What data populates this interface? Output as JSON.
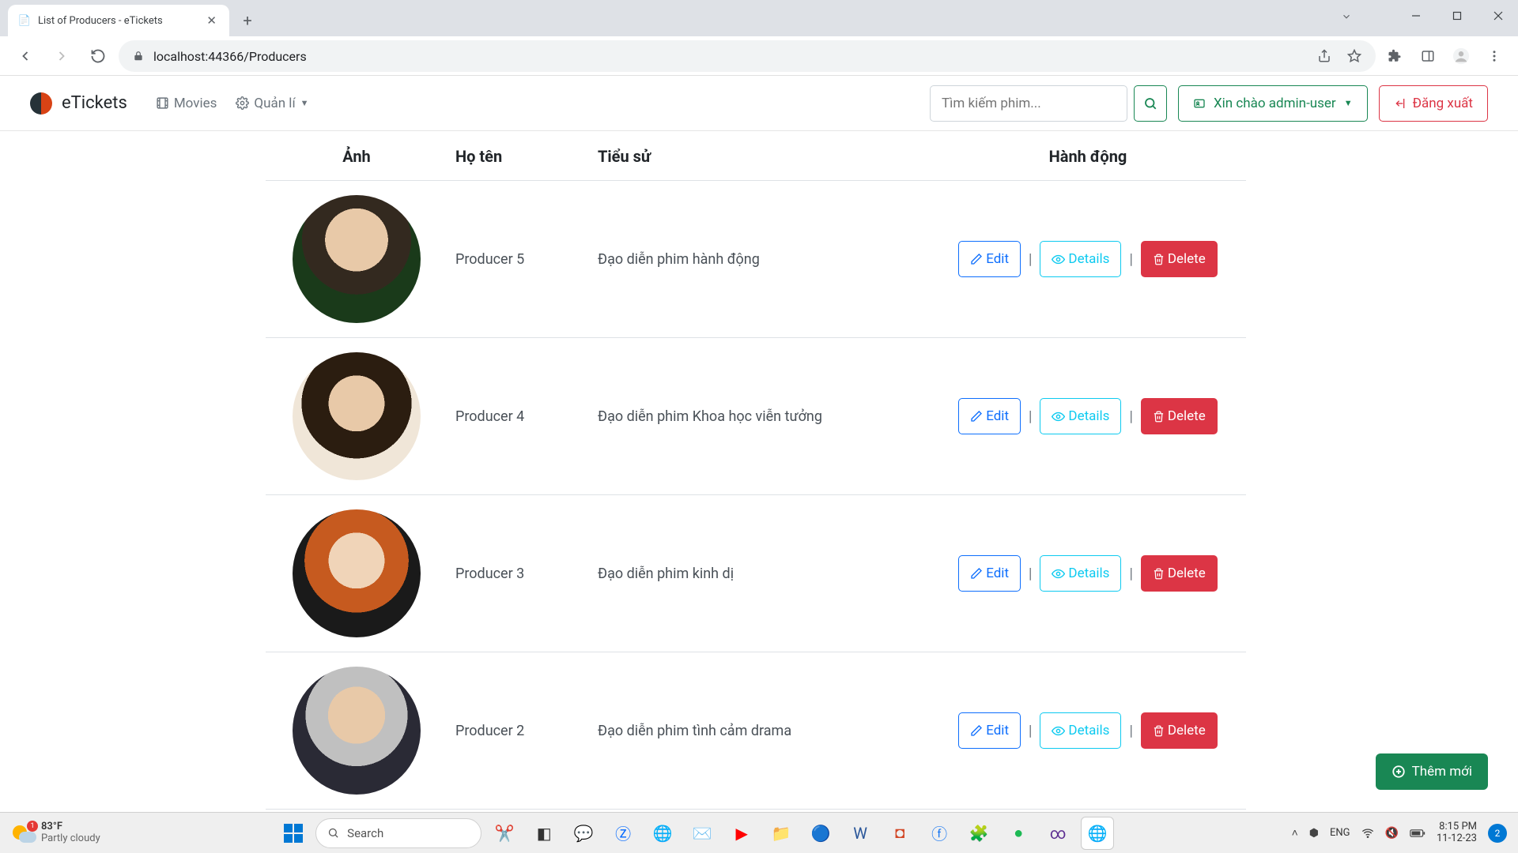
{
  "browser": {
    "tab_title": "List of Producers - eTickets",
    "address": "localhost:44366/Producers"
  },
  "navbar": {
    "brand": "eTickets",
    "movies": "Movies",
    "manage": "Quản lí",
    "search_placeholder": "Tìm kiếm phim...",
    "user_greeting": "Xin chào admin-user",
    "logout": "Đăng xuất"
  },
  "table": {
    "headers": {
      "photo": "Ảnh",
      "name": "Họ tên",
      "bio": "Tiểu sử",
      "actions": "Hành động"
    },
    "actions": {
      "edit": "Edit",
      "details": "Details",
      "delete": "Delete"
    },
    "rows": [
      {
        "name": "Producer 5",
        "bio": "Đạo diễn phim hành động"
      },
      {
        "name": "Producer 4",
        "bio": "Đạo diễn phim Khoa học viễn tưởng"
      },
      {
        "name": "Producer 3",
        "bio": "Đạo diễn phim kinh dị"
      },
      {
        "name": "Producer 2",
        "bio": "Đạo diễn phim tình cảm drama"
      }
    ]
  },
  "fab": "Thêm mới",
  "taskbar": {
    "weather_temp": "83°F",
    "weather_desc": "Partly cloudy",
    "weather_badge": "1",
    "search": "Search",
    "lang": "ENG",
    "time": "8:15 PM",
    "date": "11-12-23",
    "notif_count": "2"
  }
}
